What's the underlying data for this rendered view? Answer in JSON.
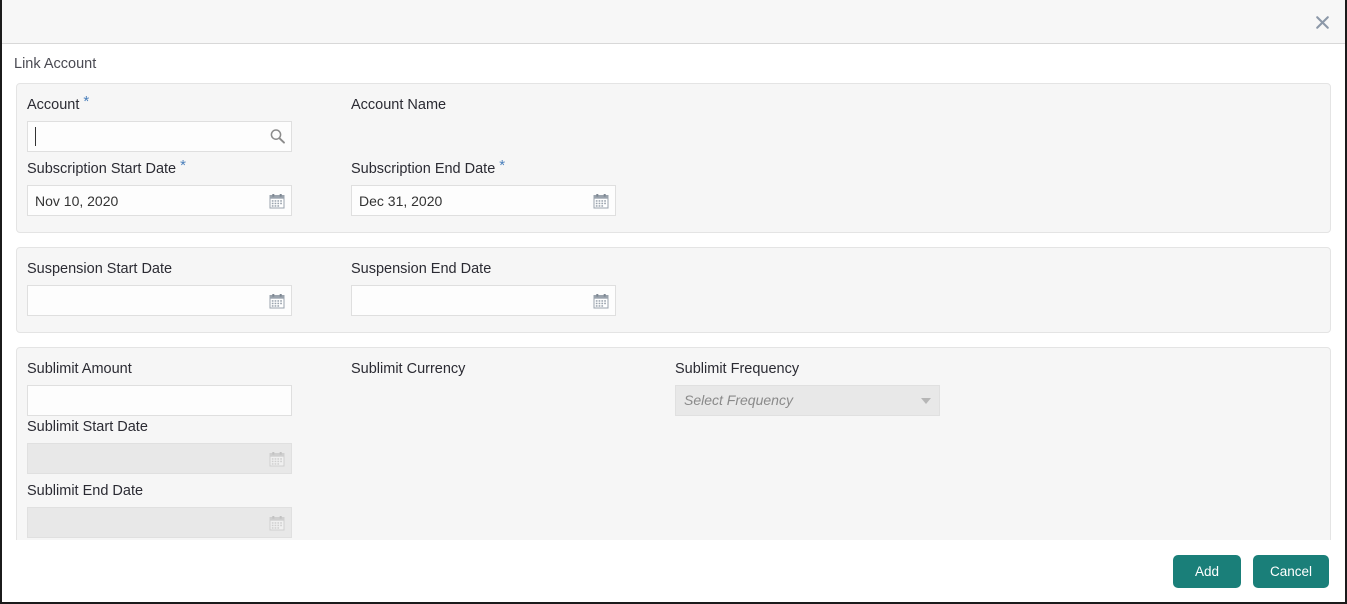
{
  "header": {
    "close_icon": "close-icon",
    "close_label": "×"
  },
  "title": "Link Account",
  "sections": [
    {
      "name": "account-section",
      "fields": [
        {
          "label": "Account",
          "required": true,
          "value": "",
          "placeholder": "",
          "icon": "search-icon",
          "disabled": false,
          "focused": true
        },
        {
          "label": "Account Name",
          "required": false,
          "value": "",
          "placeholder": "",
          "icon": "",
          "disabled": false,
          "no_input": true
        },
        {
          "label": "Subscription Start Date",
          "required": true,
          "value": "Nov 10, 2020",
          "placeholder": "",
          "icon": "calendar-icon",
          "disabled": false
        },
        {
          "label": "Subscription End Date",
          "required": true,
          "value": "Dec 31, 2020",
          "placeholder": "",
          "icon": "calendar-icon",
          "disabled": false
        }
      ]
    },
    {
      "name": "suspension-section",
      "fields": [
        {
          "label": "Suspension Start Date",
          "required": false,
          "value": "",
          "placeholder": "",
          "icon": "calendar-icon",
          "disabled": false
        },
        {
          "label": "Suspension End Date",
          "required": false,
          "value": "",
          "placeholder": "",
          "icon": "calendar-icon",
          "disabled": false
        }
      ]
    },
    {
      "name": "sublimit-section",
      "fields": [
        {
          "label": "Sublimit Amount",
          "required": false,
          "value": "",
          "placeholder": "",
          "icon": "",
          "disabled": false
        },
        {
          "label": "Sublimit Currency",
          "required": false,
          "value": "",
          "placeholder": "",
          "icon": "",
          "disabled": false,
          "no_input": true
        },
        {
          "label": "Sublimit Frequency",
          "required": false,
          "value": "Select Frequency",
          "placeholder": "Select Frequency",
          "icon": "chevron-down-icon",
          "disabled": true,
          "is_select": true
        },
        {
          "label": "Sublimit Start Date",
          "required": false,
          "value": "",
          "placeholder": "",
          "icon": "calendar-icon",
          "disabled": true
        },
        {
          "label": "Sublimit End Date",
          "required": false,
          "value": "",
          "placeholder": "",
          "icon": "calendar-icon",
          "disabled": true
        }
      ]
    }
  ],
  "footer": {
    "add_label": "Add",
    "cancel_label": "Cancel"
  },
  "colors": {
    "accent": "#1a7f79",
    "required_asterisk": "#4a7fbb",
    "panel_bg": "#f6f6f6",
    "header_bg": "#f7f7f7",
    "label_text": "#2b2b33",
    "title_text": "#4a4a52",
    "disabled_bg": "#e8e8e8"
  }
}
